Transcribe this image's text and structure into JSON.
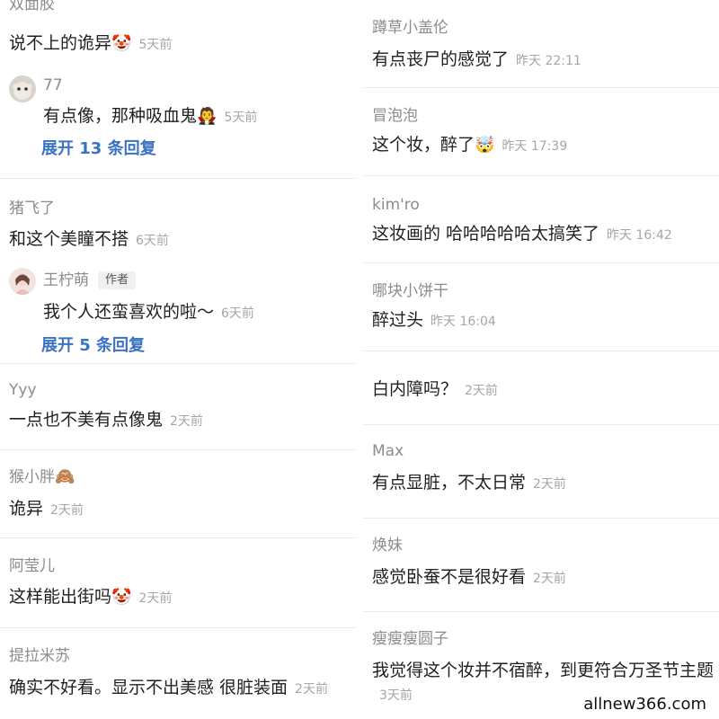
{
  "left": {
    "c1": {
      "name": "双面胶",
      "content": "说不上的诡异",
      "emoji": "🤡",
      "time": "5天前"
    },
    "c1_reply": {
      "name": "77",
      "content": "有点像，那种吸血鬼",
      "emoji": "🧛",
      "time": "5天前",
      "expand": "展开 13 条回复"
    },
    "c2": {
      "name": "猪飞了",
      "content": "和这个美瞳不搭",
      "time": "6天前"
    },
    "c2_reply": {
      "name": "王柠萌",
      "badge": "作者",
      "content": "我个人还蛮喜欢的啦～",
      "time": "6天前",
      "expand": "展开 5 条回复"
    },
    "c3": {
      "name": "Yyy",
      "content": "一点也不美有点像鬼",
      "time": "2天前"
    },
    "c4": {
      "name": "猴小胖",
      "name_emoji": "🙈",
      "content": "诡异",
      "time": "2天前"
    },
    "c5": {
      "name": "阿莹儿",
      "content": "这样能出街吗",
      "emoji": "🤡",
      "time": "2天前"
    },
    "c6": {
      "name": "提拉米苏",
      "content": "确实不好看。显示不出美感 很脏装面",
      "time": "2天前"
    }
  },
  "right": {
    "r1": {
      "name": "蹲草小盖伦",
      "content": "有点丧尸的感觉了",
      "time": "昨天 22:11"
    },
    "r2": {
      "name": "冒泡泡",
      "content": "这个妆，醉了",
      "emoji": "🤯",
      "time": "昨天 17:39"
    },
    "r3": {
      "name": "kim'ro",
      "content": "这妆画的 哈哈哈哈哈太搞笑了",
      "time": "昨天 16:42"
    },
    "r4": {
      "name": "哪块小饼干",
      "content": "醉过头",
      "time": "昨天 16:04"
    },
    "r5": {
      "content": "白内障吗？",
      "time": "2天前"
    },
    "r6": {
      "name": "Max",
      "content": "有点显脏，不太日常",
      "time": "2天前"
    },
    "r7": {
      "name": "焕妹",
      "content": "感觉卧蚕不是很好看",
      "time": "2天前"
    },
    "r8": {
      "name": "瘦瘦瘦圆子",
      "content": "我觉得这个妆并不宿醉，到更符合万圣节主题",
      "time": "3天前"
    }
  },
  "watermark": "allnew366.com"
}
